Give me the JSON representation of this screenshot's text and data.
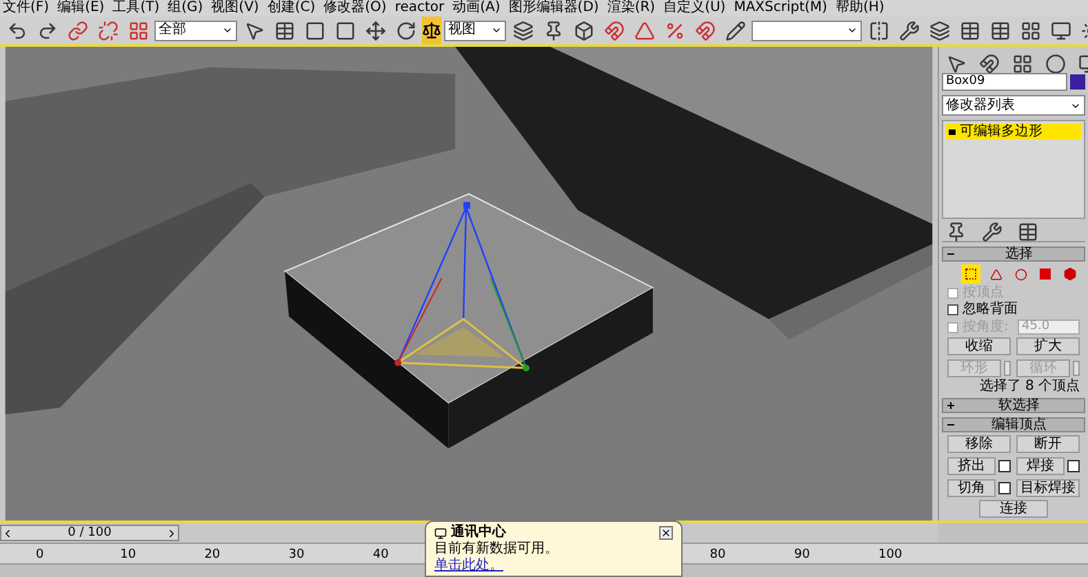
{
  "menu": [
    "文件(F)",
    "编辑(E)",
    "工具(T)",
    "组(G)",
    "视图(V)",
    "创建(C)",
    "修改器(O)",
    "reactor",
    "动画(A)",
    "图形编辑器(D)",
    "渲染(R)",
    "自定义(U)",
    "MAXScript(M)",
    "帮助(H)"
  ],
  "toolbar": {
    "selection_filter": "全部",
    "reference_coord": "视图"
  },
  "command_panel": {
    "object_name": "Box09",
    "modifier_list": "修改器列表",
    "stack": [
      {
        "label": "可编辑多边形",
        "selected": true
      }
    ],
    "rollouts": [
      {
        "kind": "open",
        "title": "选择",
        "levels": [
          {
            "selected": true
          },
          {
            "selected": false
          },
          {
            "selected": false
          },
          {
            "selected": false
          },
          {
            "selected": false
          }
        ],
        "checks": [
          {
            "label": "按顶点",
            "checked": false,
            "disabled": true
          },
          {
            "label": "忽略背面",
            "checked": false,
            "disabled": false
          },
          {
            "label": "按角度:",
            "checked": false,
            "disabled": true,
            "value": "45.0"
          }
        ],
        "buttons": [
          {
            "label": "收缩",
            "disabled": false
          },
          {
            "label": "扩大",
            "disabled": false
          },
          {
            "label": "环形",
            "disabled": true,
            "spinner": true
          },
          {
            "label": "循环",
            "disabled": true,
            "spinner": true
          }
        ],
        "status": "选择了 8 个顶点"
      },
      {
        "kind": "closed",
        "title": "软选择"
      },
      {
        "kind": "open",
        "title": "编辑顶点",
        "buttons": [
          {
            "label": "移除",
            "disabled": false
          },
          {
            "label": "断开",
            "disabled": false
          },
          {
            "label": "挤出",
            "disabled": false,
            "settings": true
          },
          {
            "label": "焊接",
            "disabled": false,
            "settings": true
          },
          {
            "label": "切角",
            "disabled": false,
            "settings": true
          },
          {
            "label": "目标焊接",
            "disabled": false
          }
        ],
        "wide_button": "连接"
      }
    ]
  },
  "timeline": {
    "frame": "0 / 100",
    "ticks": [
      "0",
      "10",
      "20",
      "30",
      "40",
      "80",
      "90",
      "100"
    ]
  },
  "notification": {
    "title": "通讯中心",
    "message": "目前有新数据可用。",
    "link": "单击此处。"
  }
}
